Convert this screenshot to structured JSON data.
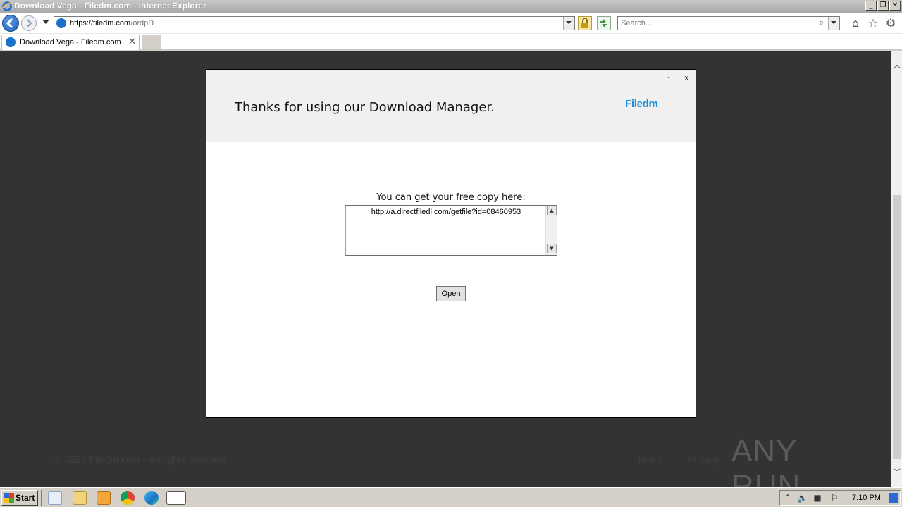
{
  "window": {
    "title": "Download Vega - Filedm.com - Internet Explorer",
    "min": "_",
    "restore": "❐",
    "close": "✕"
  },
  "address_bar": {
    "url_host": "https://filedm.com",
    "url_path": "/ordpD"
  },
  "search": {
    "placeholder": "Search..."
  },
  "tabs": [
    {
      "label": "Download Vega - Filedm.com",
      "close": "✕"
    }
  ],
  "page": {
    "footer_copyright": "© 2023 Filedm.com - All rights reserved",
    "footer_links": [
      "Terms",
      "Privacy"
    ],
    "watermark": "ANY RUN"
  },
  "modal": {
    "minimize": "-",
    "close": "x",
    "title": "Thanks for using our Download Manager.",
    "brand": "Filedm",
    "copy_label": "You can get your free copy here:",
    "download_link": "http://a.directfiledl.com/getfile?id=08460953",
    "open_button": "Open"
  },
  "taskbar": {
    "start_label": "Start",
    "clock": "7:10 PM"
  },
  "colors": {
    "page_bg": "#333333",
    "brand": "#1a8fe0",
    "modal_header_bg": "#f0f0f0"
  }
}
